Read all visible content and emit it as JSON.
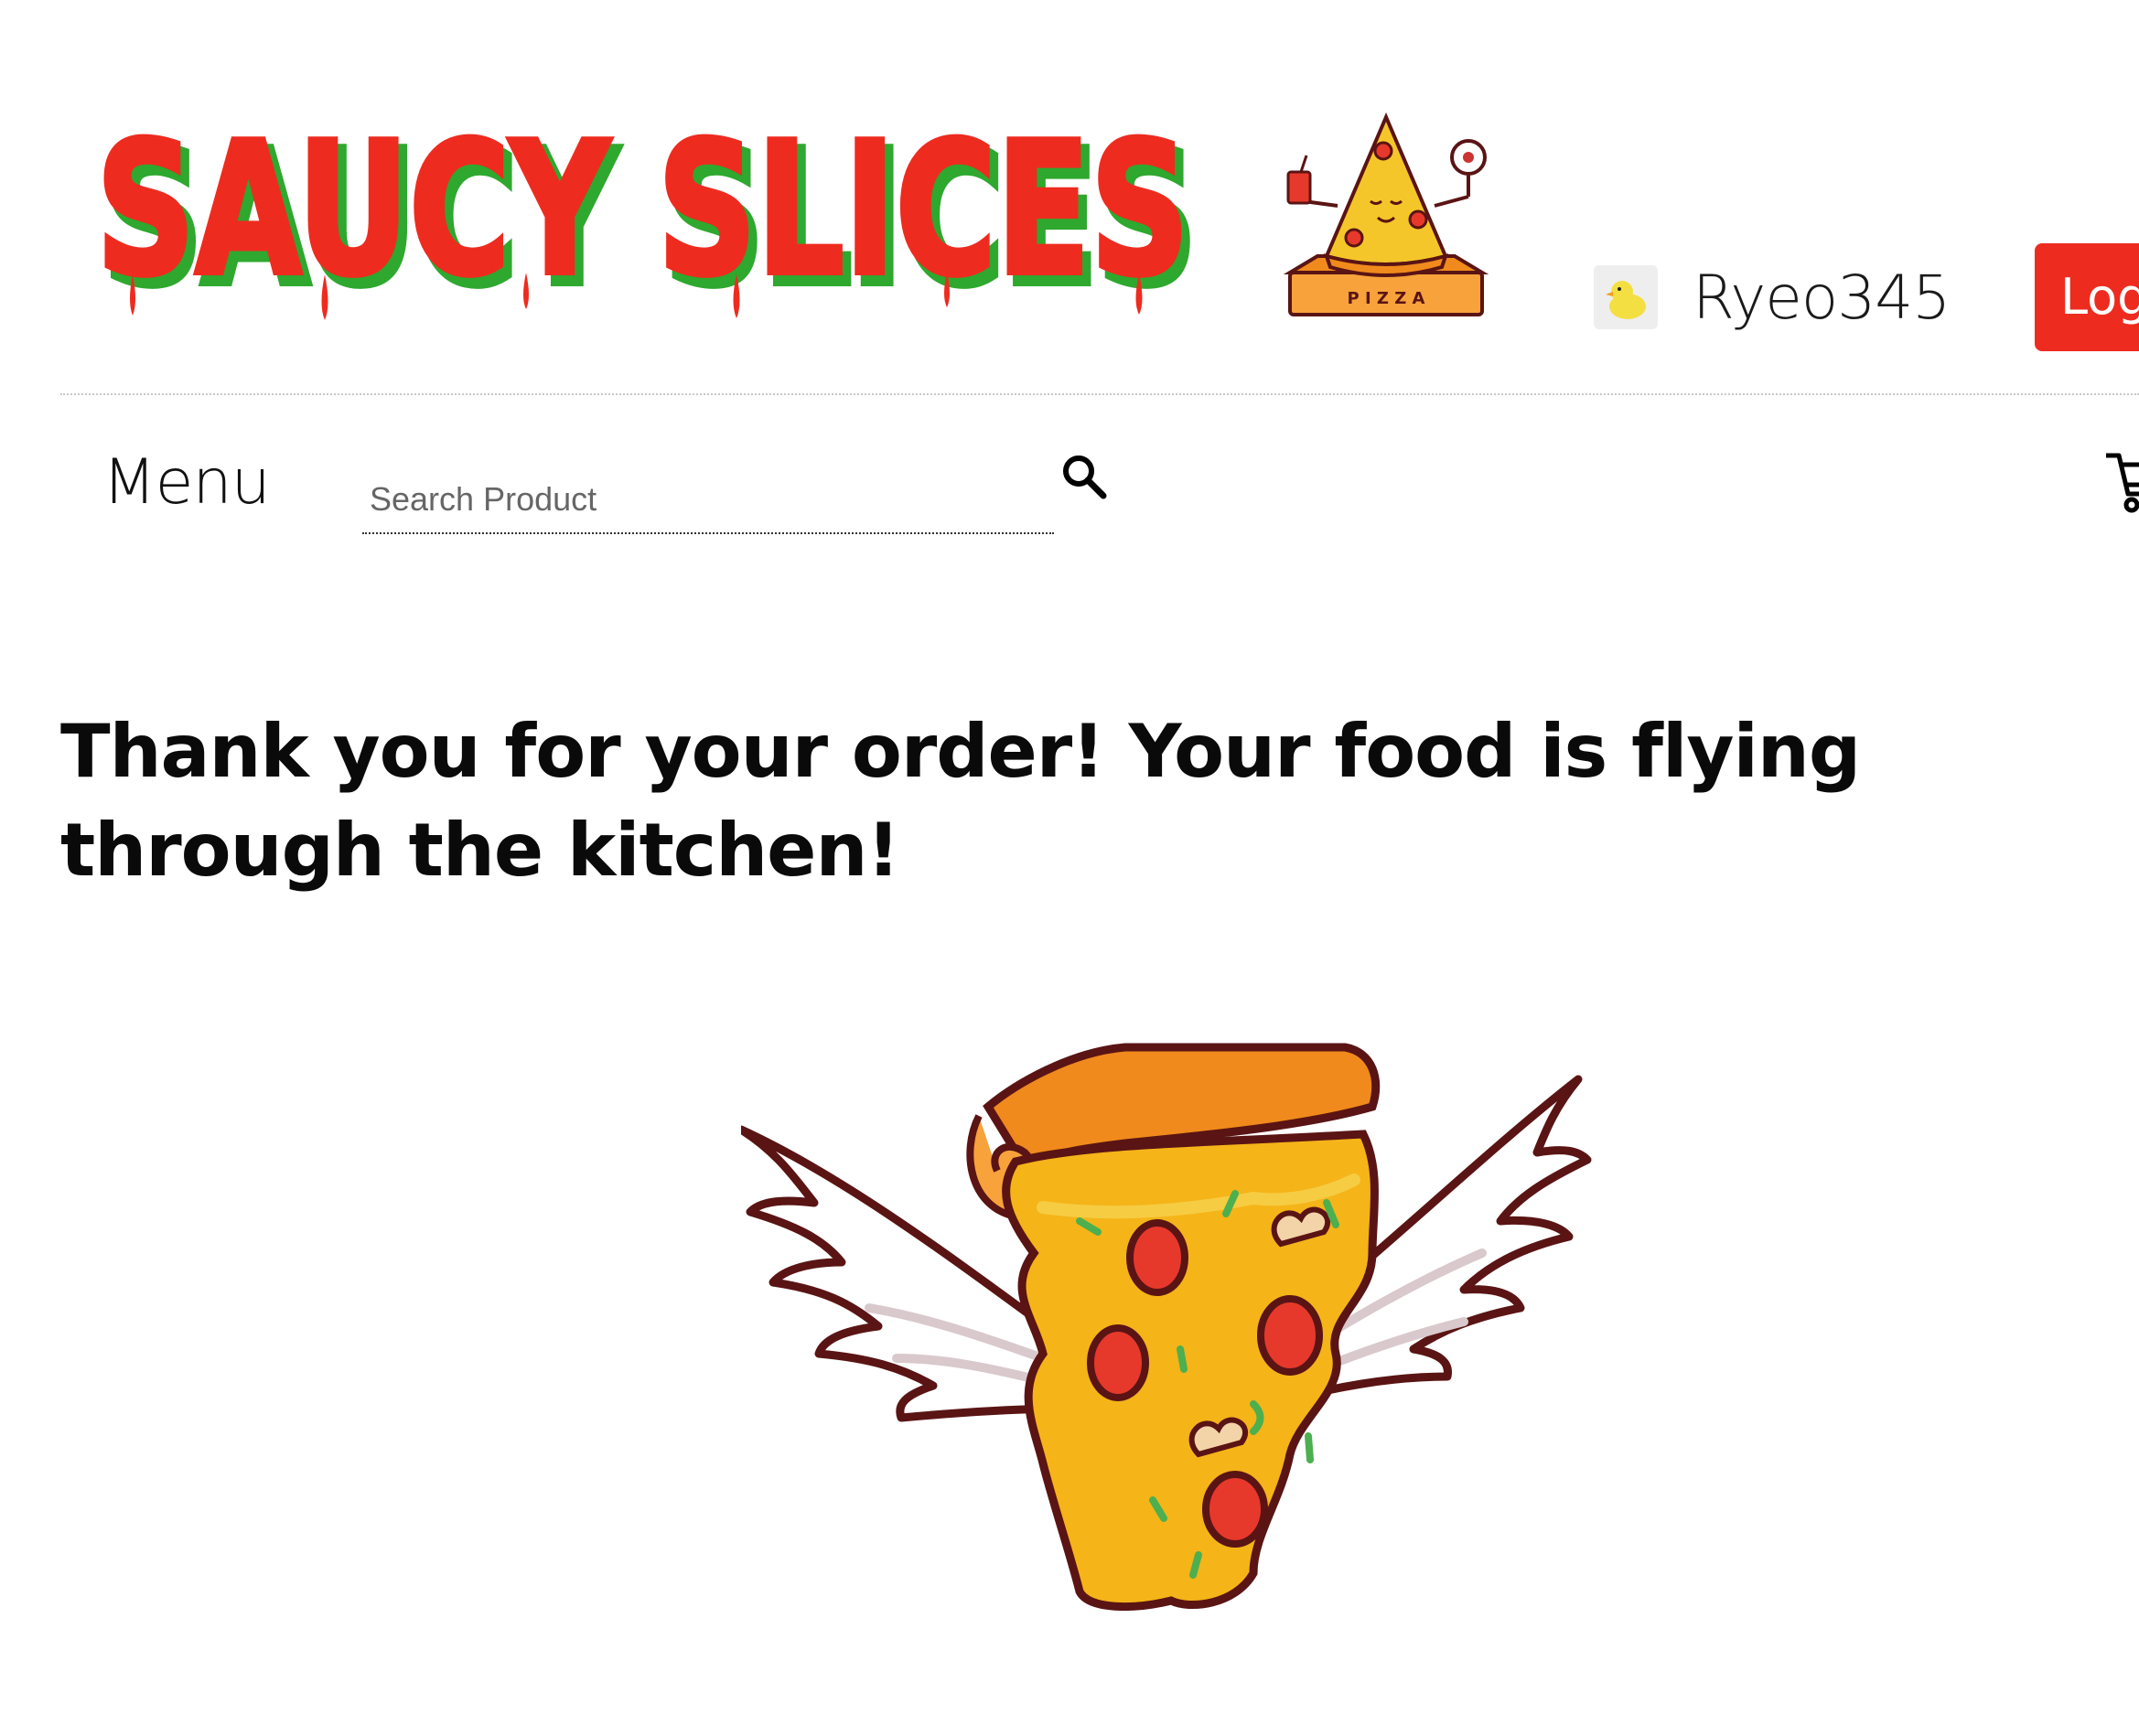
{
  "header": {
    "brand_name": "SAUCY SLICES",
    "mascot_box_text": "P I Z Z A",
    "user": {
      "username": "Ryeo345",
      "avatar_icon": "duck-icon"
    },
    "logout_label": "Log"
  },
  "nav": {
    "menu_label": "Menu",
    "search": {
      "placeholder": "Search Product",
      "value": "",
      "icon": "search-icon"
    },
    "cart_icon": "cart-icon"
  },
  "main": {
    "heading": "Thank you for your order! Your food is flying through the kitchen!",
    "image_subject": "winged-pizza-slice"
  },
  "colors": {
    "brand_red": "#ee2b1f",
    "brand_green": "#2ea82e",
    "pizza_cheese": "#f5b418",
    "pizza_crust": "#f08a1c",
    "pepperoni": "#e6392b",
    "outline": "#5a1414"
  }
}
